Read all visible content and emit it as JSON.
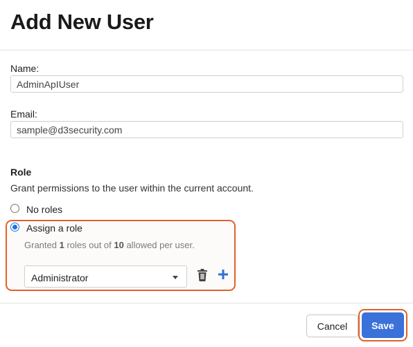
{
  "dialog": {
    "title": "Add New User"
  },
  "form": {
    "name": {
      "label": "Name:",
      "value": "AdminApIUser"
    },
    "email": {
      "label": "Email:",
      "value": "sample@d3security.com"
    }
  },
  "role_section": {
    "heading": "Role",
    "description": "Grant permissions to the user within the current account.",
    "options": [
      {
        "label": "No roles",
        "selected": false
      },
      {
        "label": "Assign a role",
        "selected": true
      }
    ],
    "granted_prefix": "Granted ",
    "granted_count": "1",
    "granted_middle": " roles out of ",
    "granted_max": "10",
    "granted_suffix": " allowed per user.",
    "selected_role": "Administrator",
    "icons": {
      "delete": "trash-icon",
      "add": "plus-icon"
    },
    "highlight_color": "#e0602a"
  },
  "footer": {
    "cancel_label": "Cancel",
    "save_label": "Save",
    "save_color": "#3a72d9"
  }
}
